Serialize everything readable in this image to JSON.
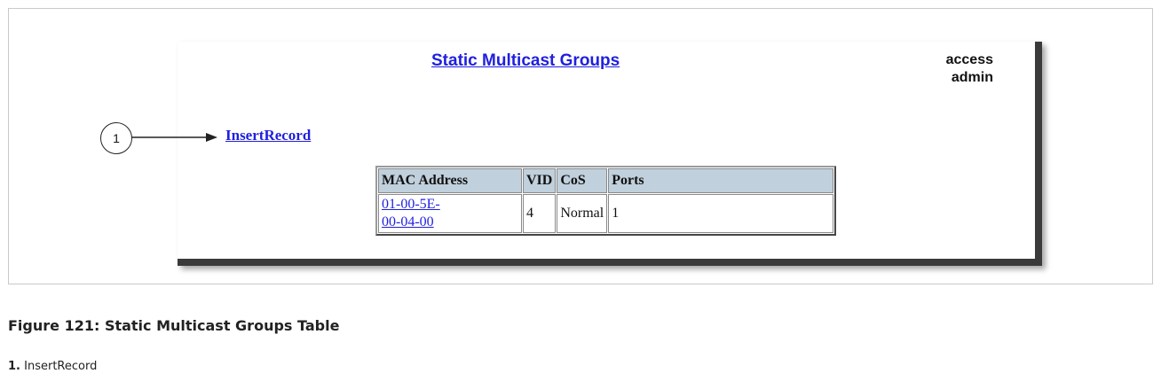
{
  "page": {
    "title": "Static Multicast Groups",
    "access_label": "access",
    "access_user": "admin",
    "insert_link": "InsertRecord"
  },
  "callout": {
    "number": "1"
  },
  "table": {
    "headers": [
      "MAC Address",
      "VID",
      "CoS",
      "Ports"
    ],
    "rows": [
      {
        "mac_line1": "01-00-5E-",
        "mac_line2": "00-04-00",
        "vid": "4",
        "cos": "Normal",
        "ports": "1"
      }
    ]
  },
  "figure": {
    "caption": "Figure 121: Static Multicast Groups Table",
    "footnote_number": "1.",
    "footnote_text": "InsertRecord"
  },
  "colors": {
    "link": "#1f1fe0",
    "table_header_bg": "#c0d0dc",
    "shadow": "#3a3a3a"
  }
}
